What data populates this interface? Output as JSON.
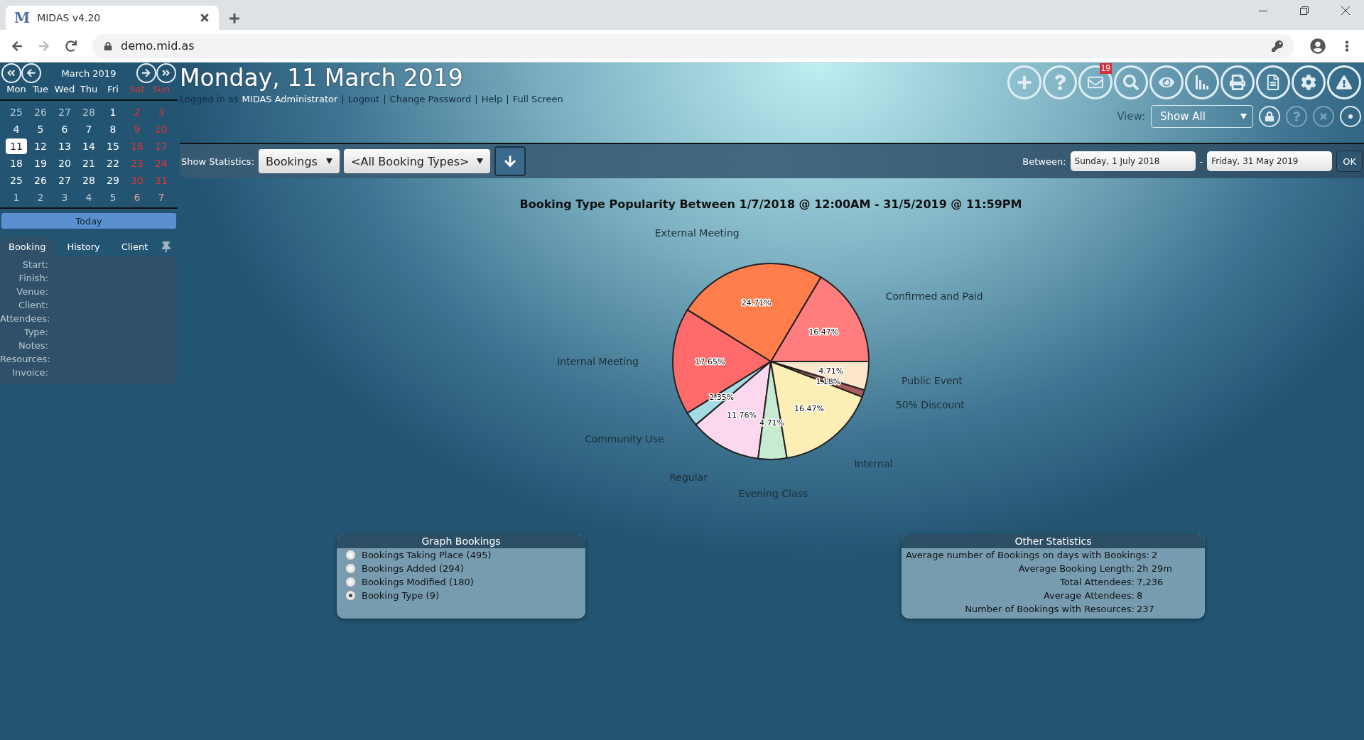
{
  "browser": {
    "logo": "M",
    "tab_title": "MIDAS v4.20",
    "url": "demo.mid.as"
  },
  "calendar": {
    "month": "March 2019",
    "weekdays": [
      "Mon",
      "Tue",
      "Wed",
      "Thu",
      "Fri",
      "Sat",
      "Sun"
    ],
    "weeks": [
      [
        {
          "label": "25",
          "outside": true,
          "selected": false
        },
        {
          "label": "26",
          "outside": true,
          "selected": false
        },
        {
          "label": "27",
          "outside": true,
          "selected": false
        },
        {
          "label": "28",
          "outside": true,
          "selected": false
        },
        {
          "label": "1",
          "outside": false,
          "selected": false
        },
        {
          "label": "2",
          "outside": false,
          "selected": false
        },
        {
          "label": "3",
          "outside": false,
          "selected": false
        }
      ],
      [
        {
          "label": "4",
          "outside": false,
          "selected": false
        },
        {
          "label": "5",
          "outside": false,
          "selected": false
        },
        {
          "label": "6",
          "outside": false,
          "selected": false
        },
        {
          "label": "7",
          "outside": false,
          "selected": false
        },
        {
          "label": "8",
          "outside": false,
          "selected": false
        },
        {
          "label": "9",
          "outside": false,
          "selected": false
        },
        {
          "label": "10",
          "outside": false,
          "selected": false
        }
      ],
      [
        {
          "label": "11",
          "outside": false,
          "selected": true
        },
        {
          "label": "12",
          "outside": false,
          "selected": false
        },
        {
          "label": "13",
          "outside": false,
          "selected": false
        },
        {
          "label": "14",
          "outside": false,
          "selected": false
        },
        {
          "label": "15",
          "outside": false,
          "selected": false
        },
        {
          "label": "16",
          "outside": false,
          "selected": false
        },
        {
          "label": "17",
          "outside": false,
          "selected": false
        }
      ],
      [
        {
          "label": "18",
          "outside": false,
          "selected": false
        },
        {
          "label": "19",
          "outside": false,
          "selected": false
        },
        {
          "label": "20",
          "outside": false,
          "selected": false
        },
        {
          "label": "21",
          "outside": false,
          "selected": false
        },
        {
          "label": "22",
          "outside": false,
          "selected": false
        },
        {
          "label": "23",
          "outside": false,
          "selected": false
        },
        {
          "label": "24",
          "outside": false,
          "selected": false
        }
      ],
      [
        {
          "label": "25",
          "outside": false,
          "selected": false
        },
        {
          "label": "26",
          "outside": false,
          "selected": false
        },
        {
          "label": "27",
          "outside": false,
          "selected": false
        },
        {
          "label": "28",
          "outside": false,
          "selected": false
        },
        {
          "label": "29",
          "outside": false,
          "selected": false
        },
        {
          "label": "30",
          "outside": false,
          "selected": false
        },
        {
          "label": "31",
          "outside": false,
          "selected": false
        }
      ],
      [
        {
          "label": "1",
          "outside": true,
          "selected": false
        },
        {
          "label": "2",
          "outside": true,
          "selected": false
        },
        {
          "label": "3",
          "outside": true,
          "selected": false
        },
        {
          "label": "4",
          "outside": true,
          "selected": false
        },
        {
          "label": "5",
          "outside": true,
          "selected": false
        },
        {
          "label": "6",
          "outside": true,
          "selected": false
        },
        {
          "label": "7",
          "outside": true,
          "selected": false
        }
      ]
    ],
    "today": "Today"
  },
  "info_panel": {
    "tabs": [
      {
        "label": "Booking",
        "selected": true
      },
      {
        "label": "History",
        "selected": false
      },
      {
        "label": "Client",
        "selected": false
      }
    ],
    "fields": [
      "Start:",
      "Finish:",
      "Venue:",
      "Client:",
      "Attendees:",
      "Type:",
      "Notes:",
      "Resources:",
      "Invoice:"
    ]
  },
  "header": {
    "date": "Monday, 11 March 2019",
    "logged_in_prefix": "Logged in as",
    "user": "MIDAS Administrator",
    "separator": "|",
    "links": [
      "Logout",
      "Change Password",
      "Help",
      "Full Screen"
    ],
    "toolbar": [
      {
        "kind": "add"
      },
      {
        "kind": "help"
      },
      {
        "kind": "mail",
        "badge": "19"
      },
      {
        "kind": "search"
      },
      {
        "kind": "view"
      },
      {
        "kind": "stats"
      },
      {
        "kind": "print"
      },
      {
        "kind": "document"
      },
      {
        "kind": "settings"
      },
      {
        "kind": "alert"
      }
    ],
    "view_label": "View:",
    "view_value": "Show All",
    "view_icons": [
      {
        "kind": "lock",
        "disabled": false
      },
      {
        "kind": "help",
        "disabled": true
      },
      {
        "kind": "close",
        "disabled": true
      },
      {
        "kind": "dot",
        "disabled": false
      }
    ]
  },
  "stats_bar": {
    "label": "Show Statistics:",
    "statistic": "Bookings",
    "booking_type": "<All Booking Types>",
    "between_label": "Between:",
    "from": "Sunday, 1 July 2018",
    "separator": "-",
    "to": "Friday, 31 May 2019",
    "ok": "OK"
  },
  "chart_data": {
    "type": "pie",
    "title": "Booking Type Popularity Between 1/7/2018 @ 12:00AM - 31/5/2019 @ 11:59PM",
    "categories": [
      "Confirmed and Paid",
      "External Meeting",
      "Internal Meeting",
      "Community Use",
      "Regular",
      "Evening Class",
      "Internal",
      "50% Discount",
      "Public Event"
    ],
    "values": [
      16.47,
      24.71,
      17.65,
      2.35,
      11.76,
      4.71,
      16.47,
      1.18,
      4.71
    ],
    "colors": [
      "#ff7d7d",
      "#ff7e4c",
      "#ff6a6a",
      "#a6dbe4",
      "#fbd8ee",
      "#c6ebd0",
      "#fdeeb6",
      "#a85c5c",
      "#fce6cc"
    ],
    "value_labels": [
      "16.47%",
      "24.71%",
      "17.65%",
      "2.35%",
      "11.76%",
      "4.71%",
      "16.47%",
      "1.18%",
      "4.71%"
    ]
  },
  "graph_bookings": {
    "title": "Graph Bookings",
    "options": [
      {
        "label": "Bookings Taking Place (495)",
        "selected": false
      },
      {
        "label": "Bookings Added (294)",
        "selected": false
      },
      {
        "label": "Bookings Modified (180)",
        "selected": false
      },
      {
        "label": "Booking Type (9)",
        "selected": true
      }
    ]
  },
  "other_statistics": {
    "title": "Other Statistics",
    "rows": [
      {
        "label": "Average number of Bookings on days with Bookings:",
        "value": "2"
      },
      {
        "label": "Average Booking Length:",
        "value": "2h 29m"
      },
      {
        "label": "Total Attendees:",
        "value": "7,236"
      },
      {
        "label": "Average Attendees:",
        "value": "8"
      },
      {
        "label": "Number of Bookings with Resources:",
        "value": "237"
      }
    ]
  }
}
